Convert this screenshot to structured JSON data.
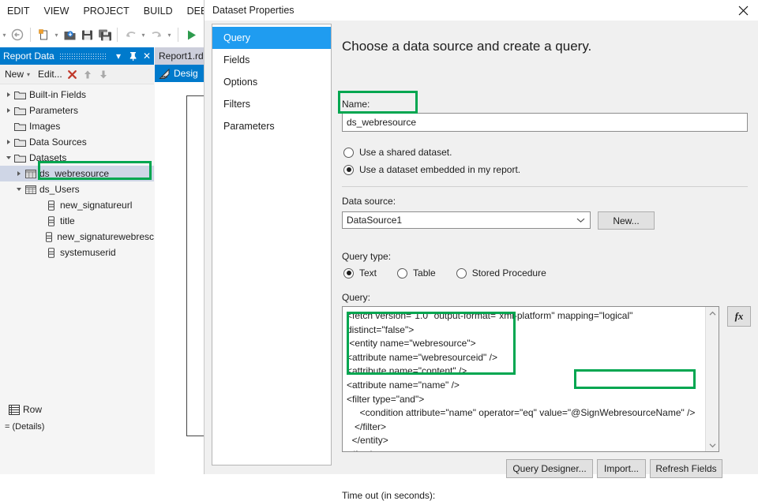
{
  "ide": {
    "menu": [
      "EDIT",
      "VIEW",
      "PROJECT",
      "BUILD",
      "DEBU"
    ],
    "toolbar_icons": [
      "new-item-icon",
      "open-file-icon",
      "save-icon",
      "save-all-icon",
      "undo-icon",
      "redo-icon",
      "start-debug-icon"
    ],
    "report_data_panel": {
      "title": "Report Data",
      "pin_icon": "pin-icon",
      "close_icon": "close-icon",
      "dropdown_icon": "chevron-down-icon",
      "toolbar": {
        "new_label": "New",
        "edit_label": "Edit...",
        "delete_icon": "red-x-icon",
        "move_up_icon": "arrow-up-icon",
        "move_down_icon": "arrow-down-icon"
      },
      "tree": [
        {
          "label": "Built-in Fields",
          "icon": "folder-icon",
          "indent": 0,
          "twisty": "closed",
          "selected": false
        },
        {
          "label": "Parameters",
          "icon": "folder-icon",
          "indent": 0,
          "twisty": "closed",
          "selected": false
        },
        {
          "label": "Images",
          "icon": "folder-icon",
          "indent": 0,
          "twisty": "none",
          "selected": false
        },
        {
          "label": "Data Sources",
          "icon": "folder-icon",
          "indent": 0,
          "twisty": "closed",
          "selected": false
        },
        {
          "label": "Datasets",
          "icon": "folder-icon",
          "indent": 0,
          "twisty": "open",
          "selected": false
        },
        {
          "label": "ds_webresource",
          "icon": "dataset-icon",
          "indent": 1,
          "twisty": "closed",
          "selected": true
        },
        {
          "label": "ds_Users",
          "icon": "dataset-icon",
          "indent": 1,
          "twisty": "open",
          "selected": false
        },
        {
          "label": "new_signatureurl",
          "icon": "field-icon",
          "indent": 3,
          "twisty": "none",
          "selected": false
        },
        {
          "label": "title",
          "icon": "field-icon",
          "indent": 3,
          "twisty": "none",
          "selected": false
        },
        {
          "label": "new_signaturewebresc",
          "icon": "field-icon",
          "indent": 3,
          "twisty": "none",
          "selected": false
        },
        {
          "label": "systemuserid",
          "icon": "field-icon",
          "indent": 3,
          "twisty": "none",
          "selected": false
        }
      ]
    },
    "document_tab": "Report1.rd",
    "designer_tab": {
      "label": "Desig",
      "icon": "design-view-icon"
    },
    "row_groups": {
      "label": "Row",
      "detail": "= (Details)",
      "icon": "row-groups-icon"
    }
  },
  "dialog": {
    "title": "Dataset Properties",
    "close_icon": "close-icon",
    "nav": [
      {
        "label": "Query",
        "active": true
      },
      {
        "label": "Fields",
        "active": false
      },
      {
        "label": "Options",
        "active": false
      },
      {
        "label": "Filters",
        "active": false
      },
      {
        "label": "Parameters",
        "active": false
      }
    ],
    "heading": "Choose a data source and create a query.",
    "name": {
      "label": "Name:",
      "value": "ds_webresource"
    },
    "source_mode": {
      "shared": {
        "label": "Use a shared dataset.",
        "selected": false
      },
      "embedded": {
        "label": "Use a dataset embedded in my report.",
        "selected": true
      }
    },
    "data_source": {
      "label": "Data source:",
      "value": "DataSource1",
      "dropdown_icon": "chevron-down-icon",
      "new_button": "New..."
    },
    "query_type": {
      "label": "Query type:",
      "options": [
        {
          "label": "Text",
          "selected": true
        },
        {
          "label": "Table",
          "selected": false
        },
        {
          "label": "Stored Procedure",
          "selected": false
        }
      ]
    },
    "query": {
      "label": "Query:",
      "text": "<fetch version=\"1.0\" output-format=\"xml-platform\" mapping=\"logical\" distinct=\"false\">\n <entity name=\"webresource\">\n<attribute name=\"webresourceid\" />\n<attribute name=\"content\" />\n<attribute name=\"name\" />\n<filter type=\"and\">\n     <condition attribute=\"name\" operator=\"eq\" value=\"@SignWebresourceName\" />\n   </filter>\n  </entity>\n</fetch>",
      "expression_button": "fx",
      "scroll_up_icon": "chevron-up-icon",
      "scroll_down_icon": "chevron-down-icon"
    },
    "buttons": {
      "query_designer": "Query Designer...",
      "import": "Import...",
      "refresh_fields": "Refresh Fields"
    },
    "timeout_label": "Time out (in seconds):"
  },
  "annotations": {
    "accent_green": "#00a650",
    "boxes": [
      {
        "name": "name-field-highlight"
      },
      {
        "name": "dataset-tree-item-highlight"
      },
      {
        "name": "query-entity-block-highlight"
      },
      {
        "name": "query-parameter-highlight"
      }
    ]
  },
  "colors": {
    "vs_blue": "#007acc",
    "nav_active": "#1f9cf0",
    "panel_bg": "#f0f0f0",
    "tree_selection": "#cfd6e6"
  }
}
